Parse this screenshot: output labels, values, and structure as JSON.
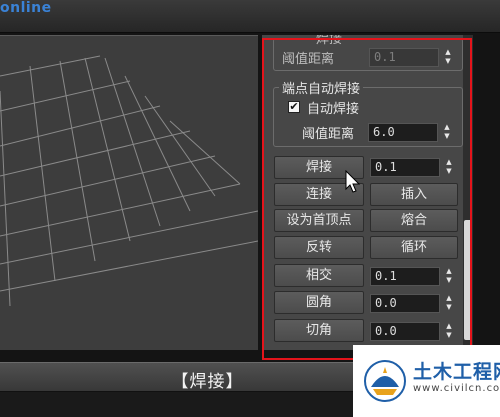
{
  "app": {
    "logo_text": "online"
  },
  "panel": {
    "group_header_partial": "焊接",
    "threshold_label": "阈值距离",
    "threshold_value": "0.1",
    "auto_weld_group": "端点自动焊接",
    "auto_weld_checkbox": "自动焊接",
    "auto_weld_checked": true,
    "auto_threshold_label": "阈值距离",
    "auto_threshold_value": "6.0",
    "buttons": {
      "weld": "焊接",
      "connect": "连接",
      "insert": "插入",
      "make_first": "设为首顶点",
      "fuse": "熔合",
      "reverse": "反转",
      "cycle": "循环",
      "cross_insert": "相交",
      "fillet": "圆角",
      "chamfer": "切角"
    },
    "weld_value": "0.1",
    "cross_insert_value": "0.1",
    "fillet_value": "0.0",
    "chamfer_value": "0.0"
  },
  "caption": "【焊接】",
  "watermark": {
    "title": "土木工程网",
    "url": "www.civilcn.com"
  },
  "colors": {
    "highlight_frame": "#e4141b",
    "watermark_brand": "#1f5fa8"
  }
}
